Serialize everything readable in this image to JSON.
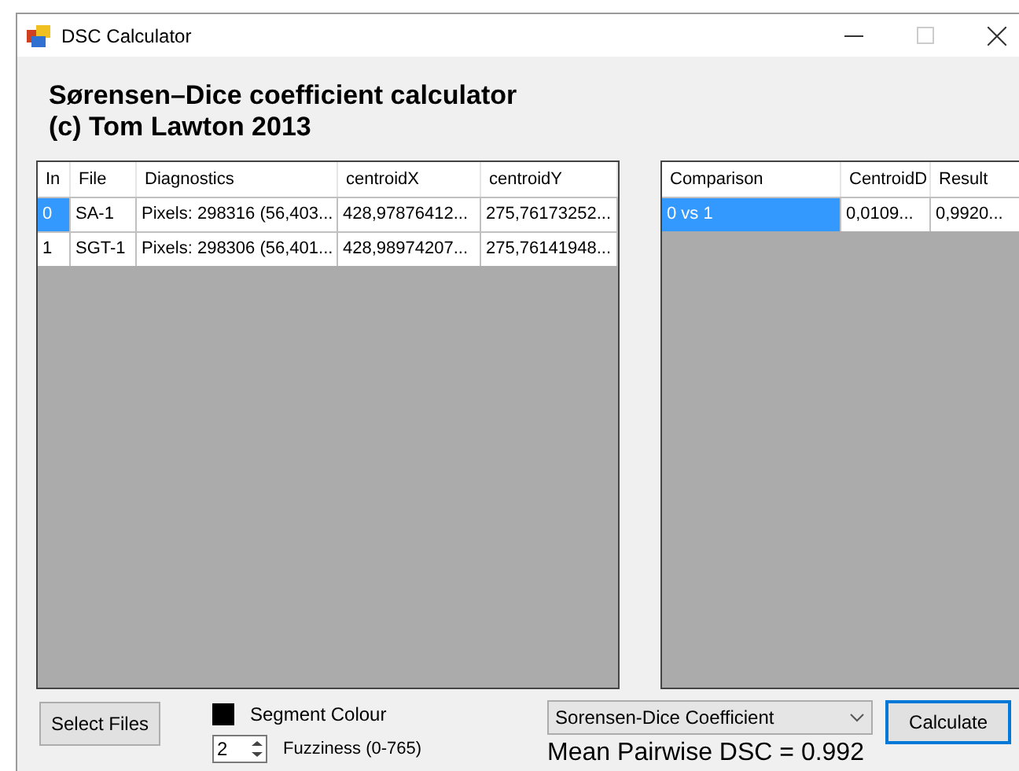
{
  "window": {
    "title": "DSC Calculator"
  },
  "heading": [
    "Sørensen–Dice coefficient calculator",
    "(c) Tom Lawton 2013"
  ],
  "files_table": {
    "columns": [
      "In",
      "File",
      "Diagnostics",
      "centroidX",
      "centroidY"
    ],
    "rows": [
      {
        "selected": true,
        "cells": [
          "0",
          "SA-1",
          "Pixels: 298316 (56,403...",
          "428,97876412...",
          "275,76173252..."
        ]
      },
      {
        "selected": false,
        "cells": [
          "1",
          "SGT-1",
          "Pixels: 298306 (56,401...",
          "428,98974207...",
          "275,76141948..."
        ]
      }
    ]
  },
  "results_table": {
    "columns": [
      "Comparison",
      "CentroidD",
      "Result"
    ],
    "rows": [
      {
        "selected": true,
        "cells": [
          "0 vs 1",
          "0,0109...",
          "0,9920..."
        ]
      }
    ]
  },
  "select_files_button": "Select Files",
  "segment_colour": {
    "label": "Segment Colour",
    "color": "#000000"
  },
  "fuzziness": {
    "value": "2",
    "label": "Fuzziness (0-765)"
  },
  "method_dropdown": {
    "value": "Sorensen-Dice Coefficient"
  },
  "calculate_button": {
    "label": "Calculate",
    "focused": true
  },
  "result_text": "Mean Pairwise DSC = 0.992"
}
